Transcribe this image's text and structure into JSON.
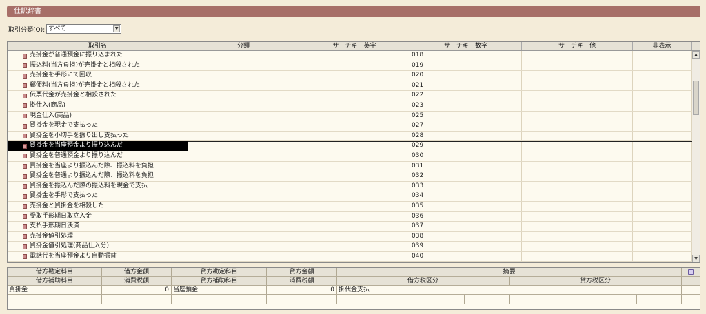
{
  "title": "仕訳辞書",
  "filter": {
    "label": "取引分類(Q):",
    "value": "すべて"
  },
  "columns": [
    "取引名",
    "分類",
    "サーチキー英字",
    "サーチキー数字",
    "サーチキー他",
    "非表示"
  ],
  "rows": [
    {
      "name": "売掛金が普通預金に振り込まれた",
      "num": "018"
    },
    {
      "name": "振込料(当方負担)が売掛金と相殺された",
      "num": "019"
    },
    {
      "name": "売掛金を手形にて回収",
      "num": "020"
    },
    {
      "name": "郵便料(当方負担)が売掛金と相殺された",
      "num": "021"
    },
    {
      "name": "伝票代金が売掛金と相殺された",
      "num": "022"
    },
    {
      "name": "掛仕入(商品)",
      "num": "023"
    },
    {
      "name": "現金仕入(商品)",
      "num": "025"
    },
    {
      "name": "買掛金を現金で支払った",
      "num": "027"
    },
    {
      "name": "買掛金を小切手を振り出し支払った",
      "num": "028"
    },
    {
      "name": "買掛金を当座預金より振り込んだ",
      "num": "029",
      "selected": true
    },
    {
      "name": "買掛金を普通預金より振り込んだ",
      "num": "030"
    },
    {
      "name": "買掛金を当座より振込んだ際、振込料を負担",
      "num": "031"
    },
    {
      "name": "買掛金を普通より振込んだ際、振込料を負担",
      "num": "032"
    },
    {
      "name": "買掛金を振込んだ際の振込料を現金で支払",
      "num": "033"
    },
    {
      "name": "買掛金を手形で支払った",
      "num": "034"
    },
    {
      "name": "売掛金と買掛金を相殺した",
      "num": "035"
    },
    {
      "name": "受取手形期日取立入金",
      "num": "036"
    },
    {
      "name": "支払手形期日決済",
      "num": "037"
    },
    {
      "name": "売掛金値引処理",
      "num": "038"
    },
    {
      "name": "買掛金値引処理(商品仕入分)",
      "num": "039"
    },
    {
      "name": "電話代を当座預金より自動振替",
      "num": "040"
    }
  ],
  "detail": {
    "header1": [
      "借方勘定科目",
      "借方金額",
      "貸方勘定科目",
      "貸方金額",
      "摘要"
    ],
    "header2": [
      "借方補助科目",
      "消費税額",
      "貸方補助科目",
      "消費税額",
      "借方税区分",
      "貸方税区分"
    ],
    "entry": {
      "debit_account": "買掛金",
      "debit_amount": "0",
      "credit_account": "当座預金",
      "credit_amount": "0",
      "memo": "掛代金支払"
    }
  }
}
